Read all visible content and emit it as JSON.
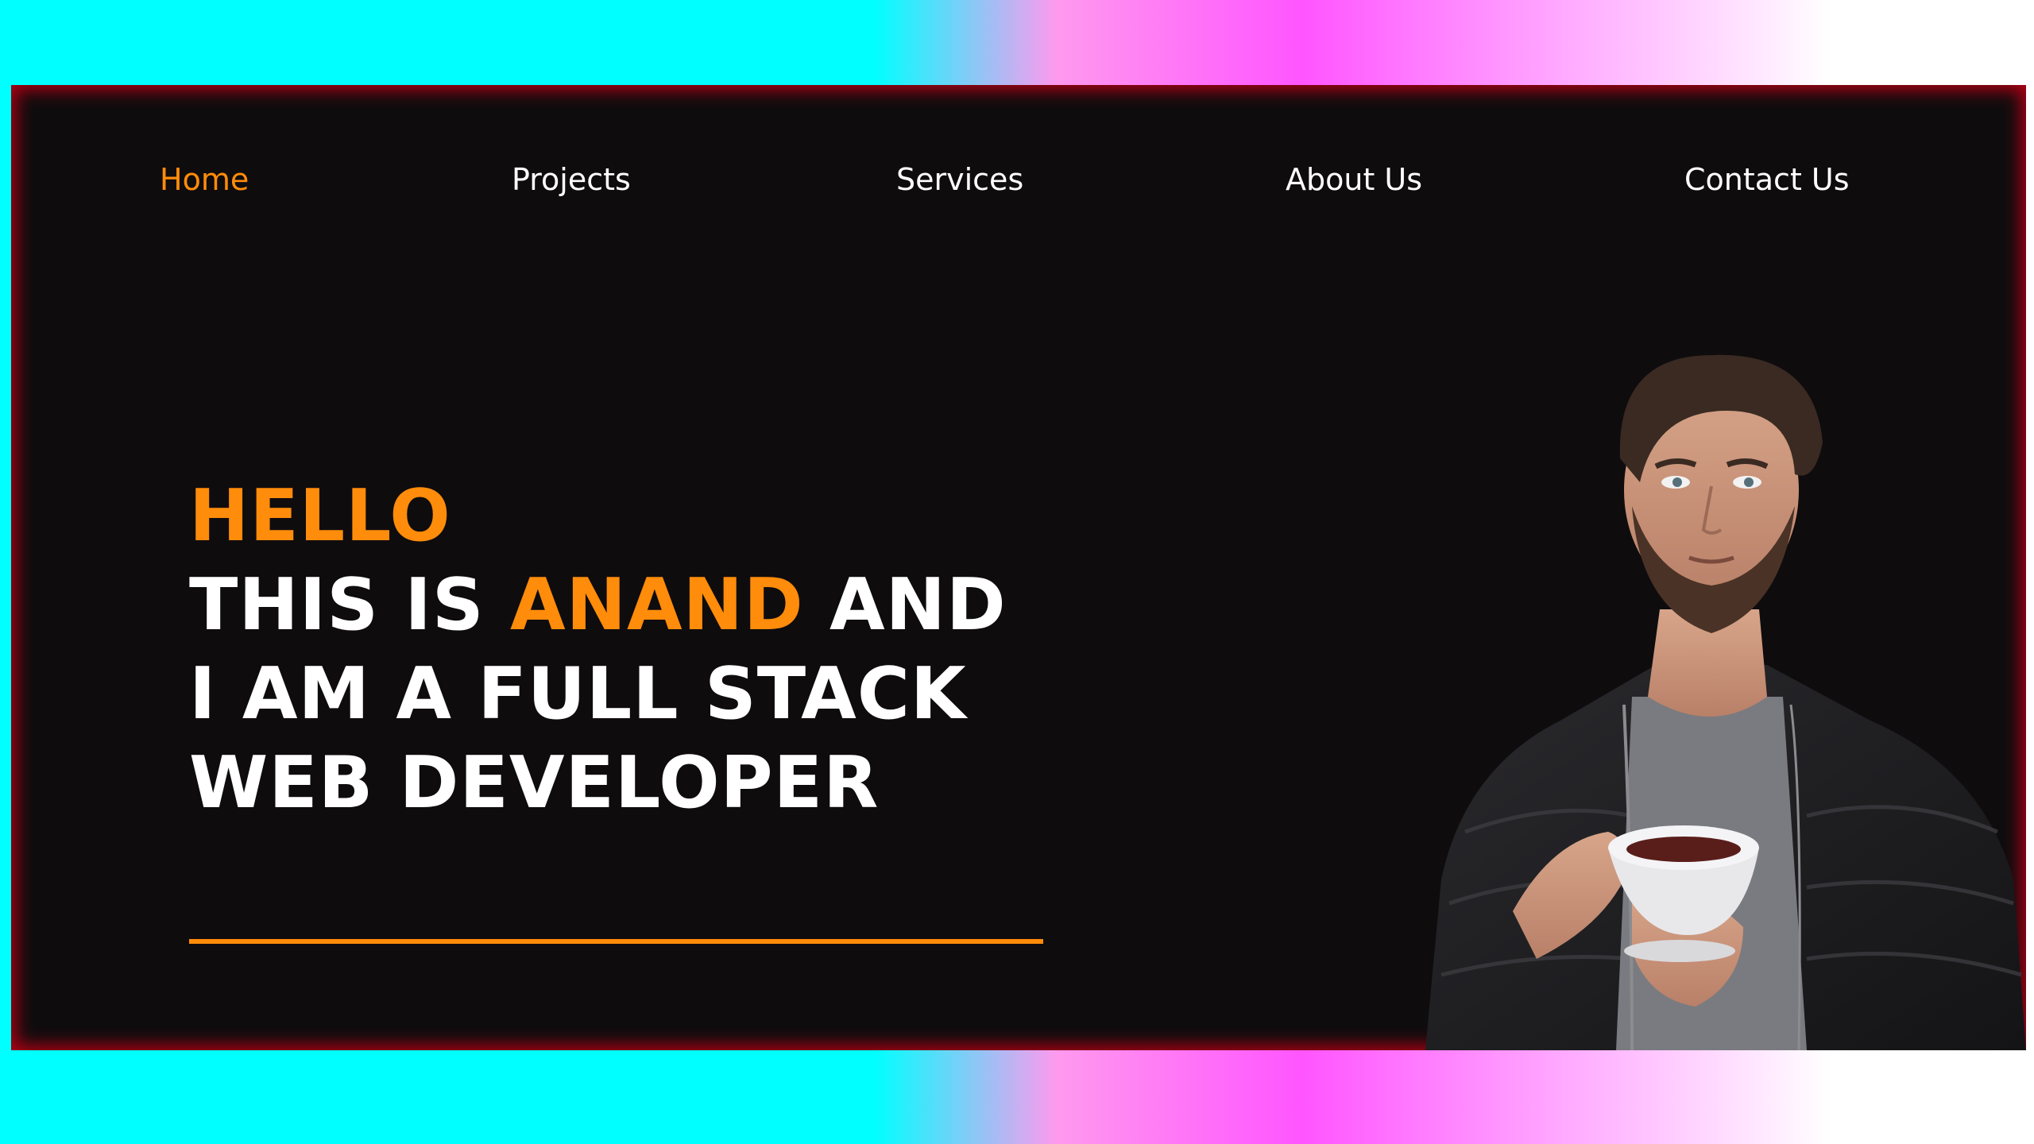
{
  "nav": {
    "items": [
      {
        "label": "Home",
        "active": true
      },
      {
        "label": "Projects",
        "active": false
      },
      {
        "label": "Services",
        "active": false
      },
      {
        "label": "About Us",
        "active": false
      },
      {
        "label": "Contact Us",
        "active": false
      }
    ]
  },
  "hero": {
    "greeting": "HELLO",
    "line2_prefix": "THIS IS ",
    "name": "ANAND",
    "line2_suffix": " AND",
    "line3": "I AM A FULL STACK",
    "line4": "WEB DEVELOPER"
  },
  "colors": {
    "accent": "#ff8c0a",
    "card_background": "#0f0c0e",
    "card_border_glow": "#be0014",
    "text": "#ffffff",
    "page_gradient": [
      "#00ffff",
      "#ff55ff",
      "#ffffff"
    ]
  },
  "portrait": {
    "icon": "person-with-coffee-cup-photo"
  }
}
